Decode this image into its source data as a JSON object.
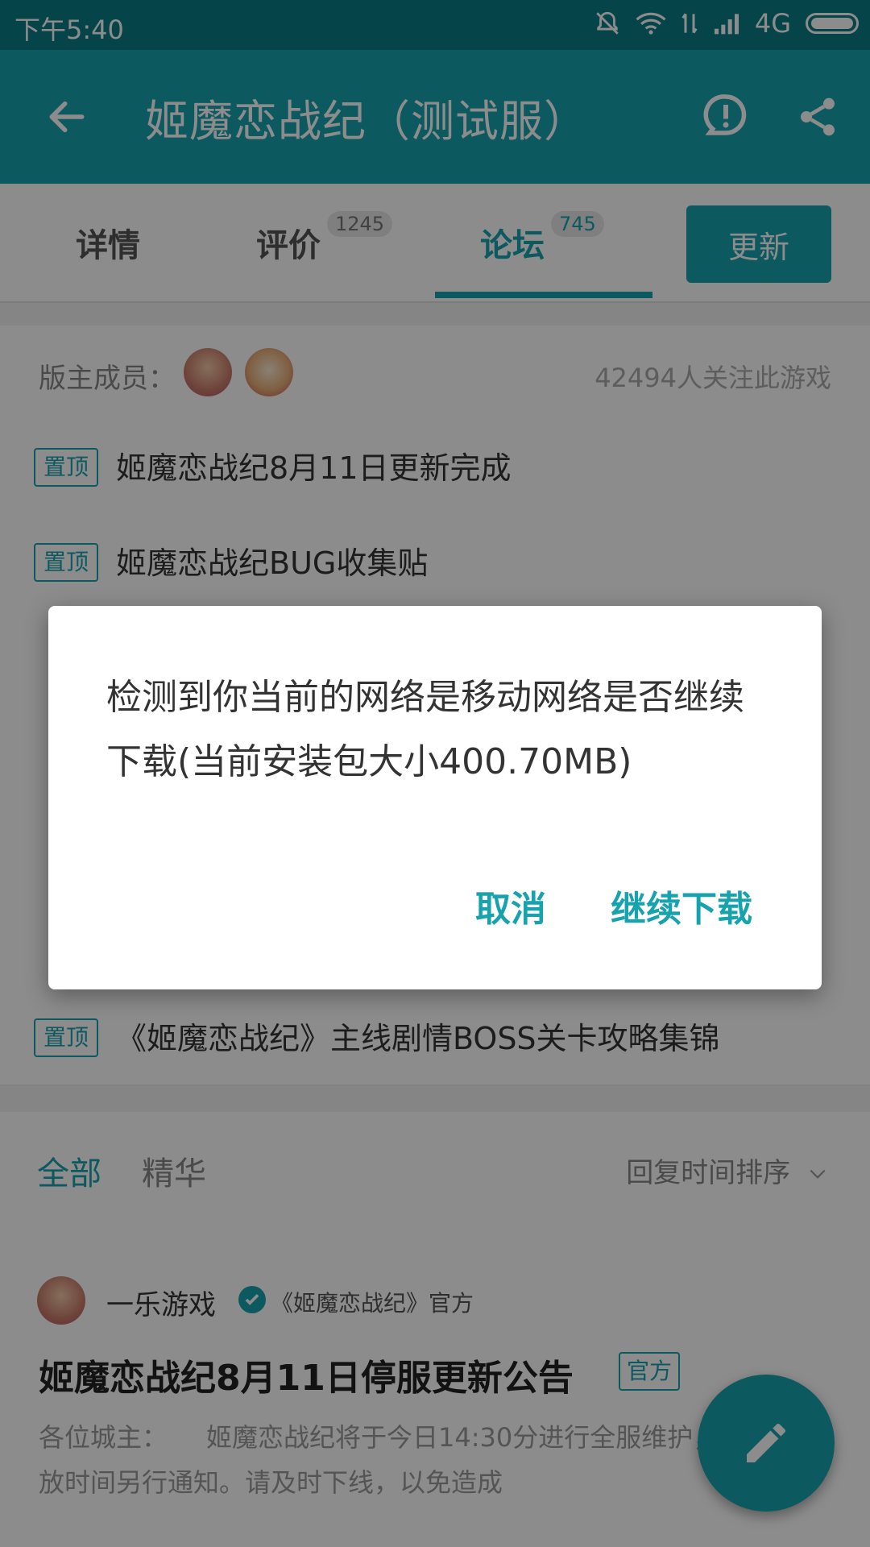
{
  "status_bar": {
    "time": "下午5:40",
    "network": "4G"
  },
  "app_bar": {
    "title": "姬魔恋战纪（测试服）"
  },
  "tabs": [
    {
      "label": "详情"
    },
    {
      "label": "评价",
      "count": "1245"
    },
    {
      "label": "论坛",
      "count": "745",
      "active": true
    }
  ],
  "update_button": "更新",
  "moderators": {
    "label": "版主成员：",
    "followers": "42494人关注此游戏"
  },
  "pinned": [
    {
      "tag": "置顶",
      "text": "姬魔恋战纪8月11日更新完成"
    },
    {
      "tag": "置顶",
      "text": "姬魔恋战纪BUG收集贴"
    },
    {
      "tag": "置顶",
      "text": "《姬魔恋战纪》主线剧情BOSS关卡攻略集锦"
    }
  ],
  "filter": {
    "all": "全部",
    "featured": "精华",
    "sort": "回复时间排序"
  },
  "post": {
    "author": "一乐游戏",
    "org": "《姬魔恋战纪》官方",
    "title": "姬魔恋战纪8月11日停服更新公告",
    "tag": "官方",
    "body": "各位城主：　　姬魔恋战纪将于今日14:30分进行全服维护，具体开放时间另行通知。请及时下线，以免造成"
  },
  "dialog": {
    "message": "检测到你当前的网络是移动网络是否继续下载(当前安装包大小400.70MB)",
    "cancel": "取消",
    "confirm": "继续下载"
  },
  "colors": {
    "primary": "#17a3ae",
    "status_bar": "#0a7c86"
  }
}
